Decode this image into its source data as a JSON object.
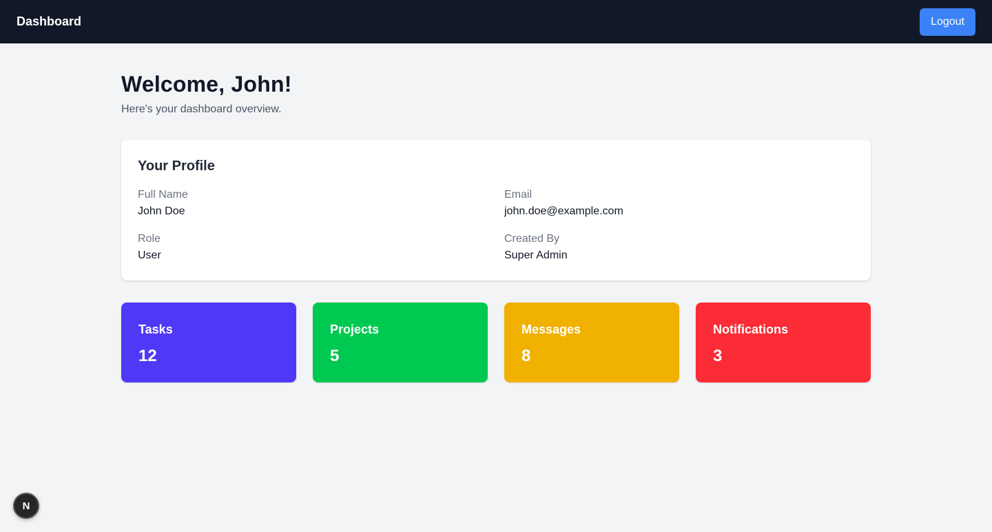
{
  "header": {
    "title": "Dashboard",
    "logout_label": "Logout"
  },
  "welcome": {
    "heading": "Welcome, John!",
    "subtitle": "Here's your dashboard overview."
  },
  "profile": {
    "title": "Your Profile",
    "fields": [
      {
        "label": "Full Name",
        "value": "John Doe"
      },
      {
        "label": "Email",
        "value": "john.doe@example.com"
      },
      {
        "label": "Role",
        "value": "User"
      },
      {
        "label": "Created By",
        "value": "Super Admin"
      }
    ]
  },
  "stats": [
    {
      "label": "Tasks",
      "value": "12",
      "color": "#4f39f6"
    },
    {
      "label": "Projects",
      "value": "5",
      "color": "#00c951"
    },
    {
      "label": "Messages",
      "value": "8",
      "color": "#f0b100"
    },
    {
      "label": "Notifications",
      "value": "3",
      "color": "#fb2c36"
    }
  ],
  "dev_badge": {
    "letter": "N",
    "icon": "nextjs-icon"
  }
}
